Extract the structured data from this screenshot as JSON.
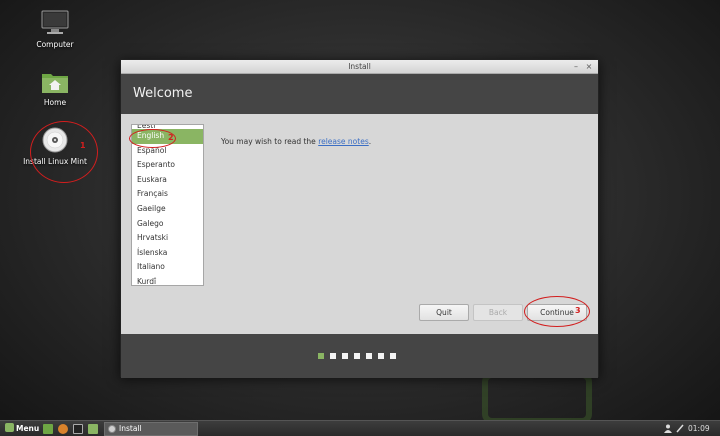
{
  "desktop": {
    "icons": [
      {
        "label": "Computer"
      },
      {
        "label": "Home"
      },
      {
        "label": "Install Linux Mint"
      }
    ]
  },
  "annotations": {
    "install_icon": "1",
    "english_item": "2",
    "continue_button": "3"
  },
  "window": {
    "title": "Install",
    "minimize_symbol": "–",
    "close_symbol": "×",
    "header_title": "Welcome"
  },
  "languages": {
    "items": [
      "Eesti",
      "English",
      "Español",
      "Esperanto",
      "Euskara",
      "Français",
      "Gaeilge",
      "Galego",
      "Hrvatski",
      "Íslenska",
      "Italiano",
      "Kurdî"
    ],
    "selected": "English"
  },
  "release_notes": {
    "prefix": "You may wish to read the ",
    "link": "release notes",
    "suffix": "."
  },
  "buttons": {
    "quit": "Quit",
    "back": "Back",
    "continue": "Continue"
  },
  "progress": {
    "total_steps": 7,
    "current_step": 1
  },
  "taskbar": {
    "menu_label": "Menu",
    "task_label": "Install",
    "clock": "01:09"
  },
  "colors": {
    "accent": "#8ab563",
    "header_bg": "#454545",
    "annotation": "#d21e1e"
  }
}
